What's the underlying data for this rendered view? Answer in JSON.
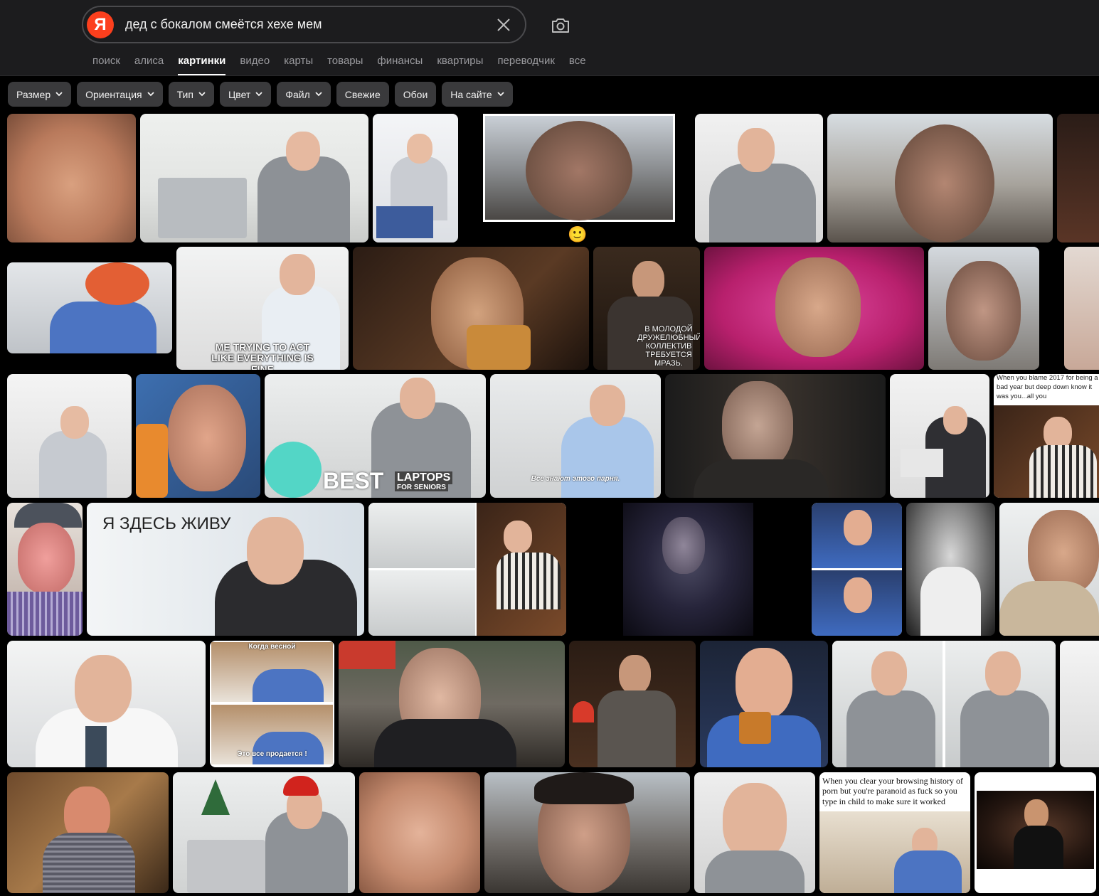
{
  "search": {
    "logo": "Я",
    "query": "дед с бокалом смеётся хехе мем"
  },
  "tabs": [
    {
      "label": "поиск",
      "active": false
    },
    {
      "label": "алиса",
      "active": false
    },
    {
      "label": "картинки",
      "active": true
    },
    {
      "label": "видео",
      "active": false
    },
    {
      "label": "карты",
      "active": false
    },
    {
      "label": "товары",
      "active": false
    },
    {
      "label": "финансы",
      "active": false
    },
    {
      "label": "квартиры",
      "active": false
    },
    {
      "label": "переводчик",
      "active": false
    },
    {
      "label": "все",
      "active": false
    }
  ],
  "filters": [
    {
      "label": "Размер",
      "dropdown": true
    },
    {
      "label": "Ориентация",
      "dropdown": true
    },
    {
      "label": "Тип",
      "dropdown": true
    },
    {
      "label": "Цвет",
      "dropdown": true
    },
    {
      "label": "Файл",
      "dropdown": true
    },
    {
      "label": "Свежие",
      "dropdown": false
    },
    {
      "label": "Обои",
      "dropdown": false
    },
    {
      "label": "На сайте",
      "dropdown": true
    }
  ],
  "captions": {
    "fine": "ME TRYING TO ACT LIKE EVERYTHING IS FINE",
    "collective": "В МОЛОДОЙ ДРУЖЕЛЮБНЫЙ КОЛЛЕКТИВ ТРЕБУЕТСЯ МРАЗЬ.",
    "blame2017": "When you blame 2017 for being a bad year but deep down know it was you...all you",
    "best": "BEST",
    "laptops": "LAPTOPS",
    "seniors": "FOR SENIORS",
    "everyone_knows": "Все знают этого парня.",
    "live_here": "Я ЗДЕСЬ ЖИВУ",
    "spring": "Когда весной",
    "sold": "Это все продается !",
    "browsing": "When you clear your browsing history of porn but you're paranoid as fuck so you type in child to make sure it worked"
  },
  "emoji": "🙂",
  "colors": {
    "header_bg": "#1c1c1e",
    "filter_bg": "#3a3a3c",
    "logo_red": "#fc3f1d"
  }
}
